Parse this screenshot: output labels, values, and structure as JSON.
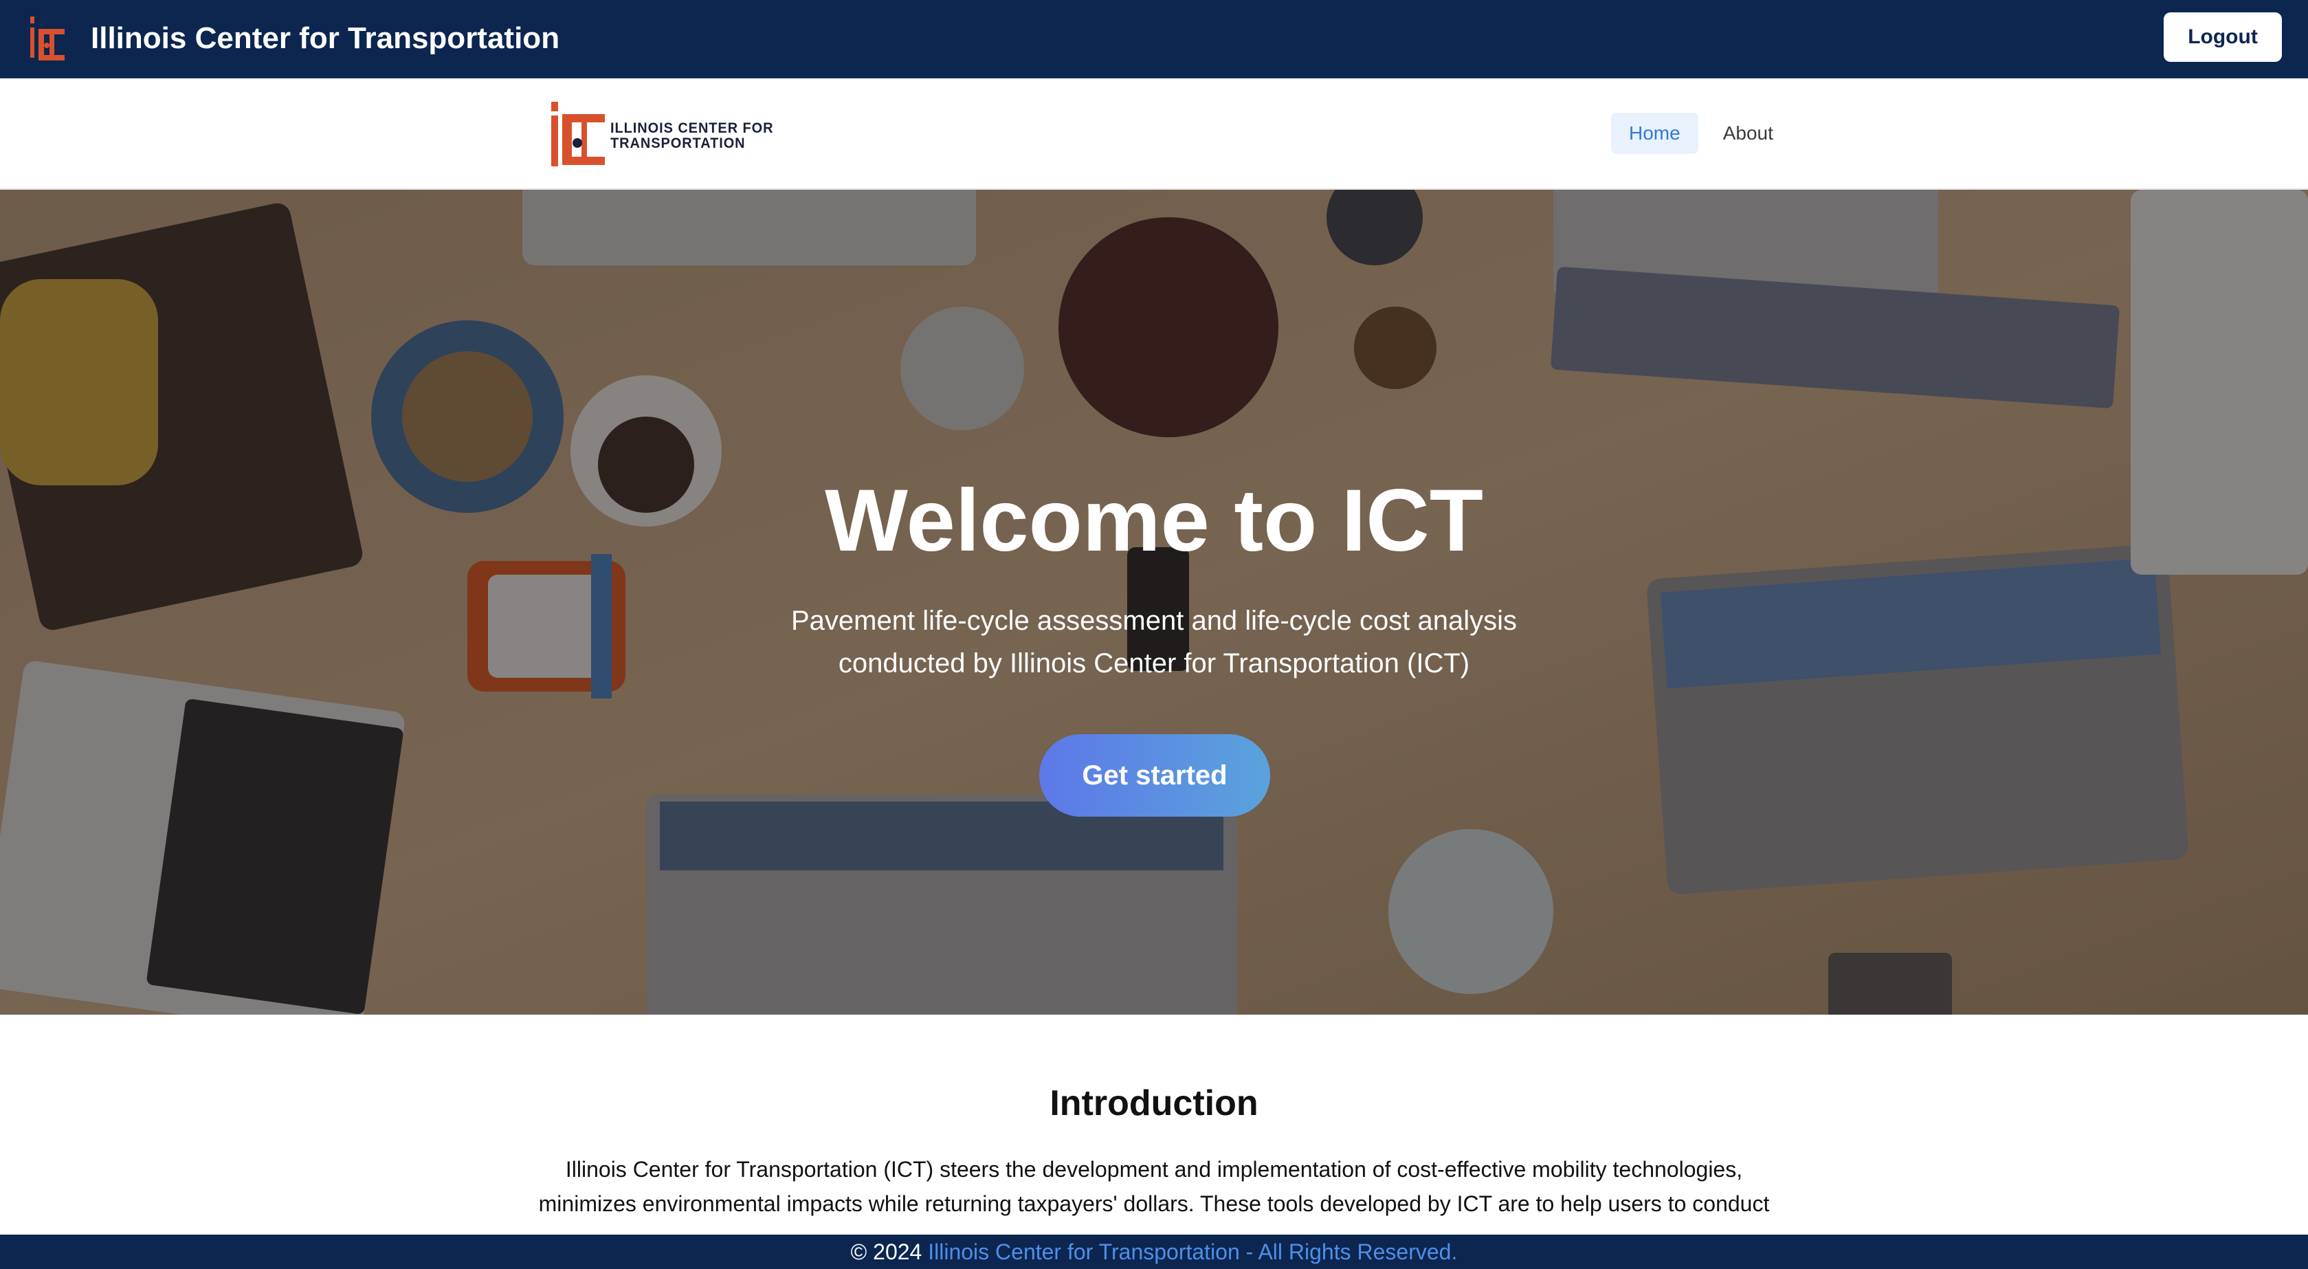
{
  "appbar": {
    "title": "Illinois Center for Transportation",
    "logout_label": "Logout"
  },
  "navbar": {
    "logo_text": "ILLINOIS CENTER FOR\nTRANSPORTATION",
    "links": [
      {
        "label": "Home",
        "active": true
      },
      {
        "label": "About",
        "active": false
      }
    ]
  },
  "hero": {
    "title": "Welcome to ICT",
    "subtitle": "Pavement life-cycle assessment and life-cycle cost analysis conducted by Illinois Center for Transportation (ICT)",
    "cta_label": "Get started"
  },
  "intro": {
    "title": "Introduction",
    "text": "Illinois Center for Transportation (ICT) steers the development and implementation of cost-effective mobility technologies, minimizes environmental impacts while returning taxpayers' dollars. These tools developed by ICT are to help users to conduct"
  },
  "footer": {
    "copyright": "© 2024",
    "link_text": "Illinois Center for Transportation - All Rights Reserved."
  },
  "colors": {
    "brand_navy": "#0c2650",
    "brand_orange": "#d9512c",
    "link_blue": "#4f8fe8",
    "cta_gradient_start": "#5d78e8",
    "cta_gradient_end": "#5aa3dc"
  },
  "icons": {
    "appbar_logo": "ict-logo-icon",
    "nav_logo": "ict-logo-icon"
  }
}
